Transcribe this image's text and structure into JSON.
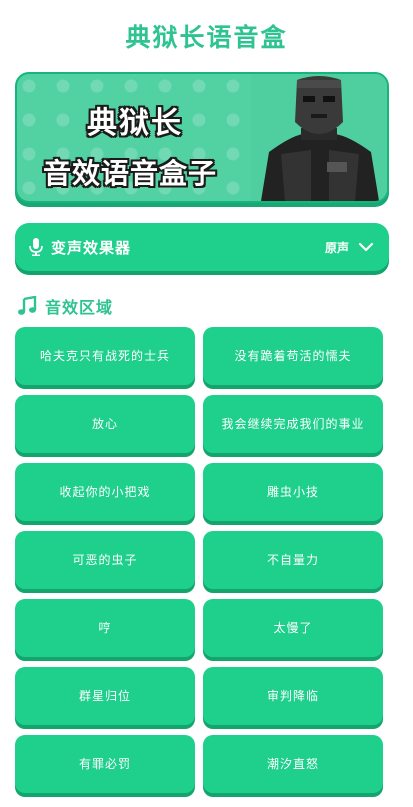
{
  "page": {
    "title": "典狱长语音盒"
  },
  "banner": {
    "line1": "典狱长",
    "line2": "音效语音盒子"
  },
  "voice_changer": {
    "label": "变声效果器",
    "value": "原声"
  },
  "section": {
    "label": "音效区域"
  },
  "sounds": [
    "哈夫克只有战死的士兵",
    "没有跪着苟活的懦夫",
    "放心",
    "我会继续完成我们的事业",
    "收起你的小把戏",
    "雕虫小技",
    "可恶的虫子",
    "不自量力",
    "哼",
    "太慢了",
    "群星归位",
    "审判降临",
    "有罪必罚",
    "潮汐直怒"
  ],
  "colors": {
    "accent": "#1fcf8c",
    "title": "#2ec391"
  }
}
